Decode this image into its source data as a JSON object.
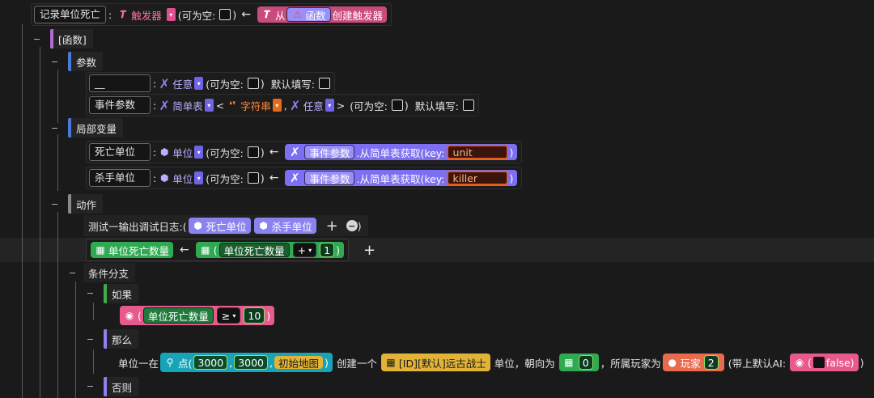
{
  "record": {
    "name": "记录单位死亡",
    "type_label": "触发器",
    "nullable_label": "(可为空:",
    "close": ")",
    "from_label": "从",
    "func_label": "函数",
    "create_label": "创建触发器"
  },
  "func_block": {
    "label": "[函数]"
  },
  "params": {
    "label": "参数",
    "rows": [
      {
        "name": "__",
        "type": "任意",
        "nullable": "(可为空:",
        "close": ")",
        "default": "默认填写:"
      },
      {
        "name": "事件参数",
        "type": "简单表",
        "lt": "<",
        "sub1": "字符串",
        "comma": ",",
        "sub2": "任意",
        "gt": ">",
        "nullable": "(可为空:",
        "close": ")",
        "default": "默认填写:"
      }
    ]
  },
  "locals": {
    "label": "局部变量",
    "rows": [
      {
        "name": "死亡单位",
        "type": "单位",
        "nullable": "(可为空:",
        "close": ")",
        "param": "事件参数",
        "method": ".从简单表获取(key:",
        "key": "unit"
      },
      {
        "name": "杀手单位",
        "type": "单位",
        "nullable": "(可为空:",
        "close": ")",
        "param": "事件参数",
        "method": ".从简单表获取(key:",
        "key": "killer"
      }
    ]
  },
  "actions": {
    "label": "动作",
    "log": {
      "text": "测试一输出调试日志:(",
      "a1": "死亡单位",
      "a2": "杀手单位",
      "plus": "+",
      "minus": "−",
      "close": ")"
    },
    "assign": {
      "var": "单位死亡数量",
      "var2": "单位死亡数量",
      "op": "+",
      "num": "1",
      "plus": "+"
    }
  },
  "branch": {
    "label": "条件分支",
    "if": "如果",
    "cond_var": "单位死亡数量",
    "cond_op": "≥",
    "cond_num": "10",
    "then": "那么",
    "else": "否则"
  },
  "create": {
    "prefix": "单位一在",
    "point": "点(",
    "x": "3000",
    "comma": ",",
    "y": "3000",
    "map": "初始地图",
    "mid": "创建一个",
    "unit_type": "[ID][默认]远古战士",
    "face": "单位，朝向为",
    "face_num": "0",
    "owner": "，所属玩家为",
    "player": "玩家",
    "player_num": "2",
    "ai": "(带上默认AI:",
    "bool": "false",
    "close": ")"
  }
}
